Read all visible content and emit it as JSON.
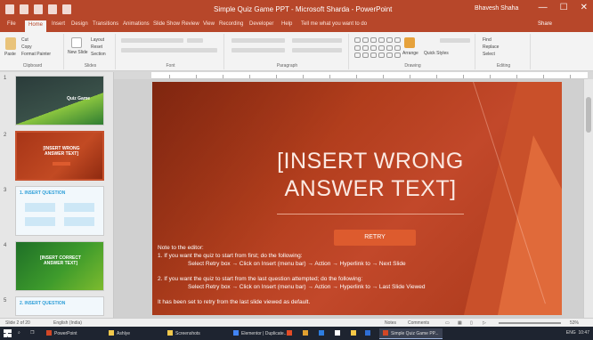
{
  "window": {
    "title": "Simple Quiz Game PPT - Microsoft Sharda - PowerPoint",
    "user": "Bhavesh Shaha",
    "controls": [
      "—",
      "☐",
      "✕"
    ]
  },
  "tabs": [
    "File",
    "Home",
    "Insert",
    "Design",
    "Transitions",
    "Animations",
    "Slide Show",
    "Review",
    "View",
    "Recording",
    "Developer",
    "Help"
  ],
  "tell_me": "Tell me what you want to do",
  "share_label": "Share",
  "ribbon": {
    "groups": [
      "Clipboard",
      "Slides",
      "Font",
      "Paragraph",
      "Drawing",
      "Editing"
    ],
    "paste_label": "Paste",
    "cut_label": "Cut",
    "copy_label": "Copy",
    "format_painter_label": "Format Painter",
    "new_slide_label": "New Slide",
    "layout_label": "Layout",
    "reset_label": "Reset",
    "section_label": "Section",
    "find_label": "Find",
    "replace_label": "Replace",
    "select_label": "Select",
    "arrange_label": "Arrange",
    "quick_styles_label": "Quick Styles"
  },
  "thumbnails": [
    {
      "num": "1",
      "title": "Quiz Game"
    },
    {
      "num": "2",
      "title": "[INSERT WRONG ANSWER TEXT]"
    },
    {
      "num": "3",
      "title": "1. INSERT QUESTION"
    },
    {
      "num": "4",
      "title": "[INSERT CORRECT ANSWER TEXT]"
    },
    {
      "num": "5",
      "title": "2. INSERT QUESTION"
    }
  ],
  "slide": {
    "title_line1": "[INSERT WRONG",
    "title_line2": "ANSWER TEXT]",
    "retry_label": "RETRY",
    "note_heading": "Note to the editor:",
    "note_item1": "1.   If you want the quiz to start from first; do the following:",
    "note_item1_steps": "Select Retry box → Click on Insert (menu bar) → Action → Hyperlink to → Next Slide",
    "note_item2": "2.   If you want the quiz to start from the last question attempted; do the following:",
    "note_item2_steps": "Select Retry box → Click on Insert (menu bar) → Action → Hyperlink to → Last Slide Viewed",
    "note_footer": "It has been set to retry from the last slide viewed as default."
  },
  "status": {
    "slide_indicator": "Slide 2 of 20",
    "language": "English (India)",
    "notes_label": "Notes",
    "comments_label": "Comments",
    "zoom": "53%"
  },
  "taskbar": {
    "items": [
      "PowerPoint",
      "Ashlye",
      "Screenshots",
      "Elementor | Duplicate...",
      "Simple Quiz Game PP..."
    ],
    "clock": "10:47",
    "tray_lang": "ENG"
  },
  "colors": {
    "accent": "#b7472a",
    "slide_bg": "#b13d1c",
    "retry_button": "#dd5b2e"
  }
}
